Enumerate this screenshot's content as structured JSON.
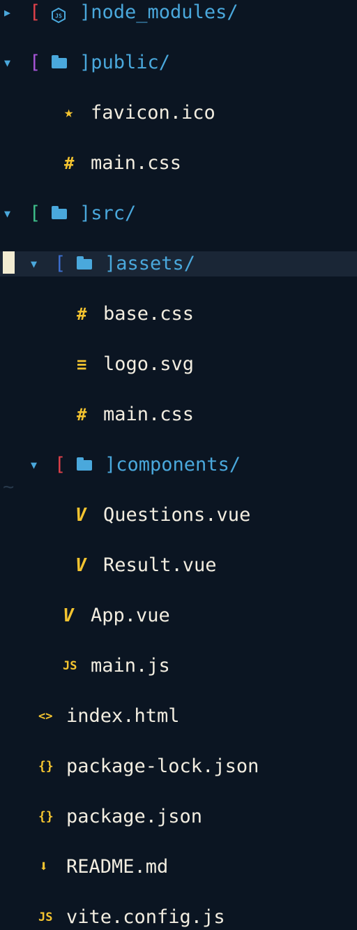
{
  "tree": {
    "node_modules": {
      "open_bracket": "[",
      "close_bracket": "]",
      "label": "node_modules/",
      "arrow": "▶",
      "icon": "nodejs-icon"
    },
    "public": {
      "open_bracket": "[",
      "close_bracket": "]",
      "label": "public/",
      "arrow": "▼"
    },
    "public_children": [
      {
        "label": "favicon.ico",
        "icon_glyph": "★",
        "icon": "star-icon"
      },
      {
        "label": "main.css",
        "icon_glyph": "#",
        "icon": "hash-icon"
      }
    ],
    "src": {
      "open_bracket": "[",
      "close_bracket": "]",
      "label": "src/",
      "arrow": "▼"
    },
    "assets": {
      "open_bracket": "[",
      "close_bracket": "]",
      "label": "assets/",
      "arrow": "▼"
    },
    "assets_children": [
      {
        "label": "base.css",
        "icon_glyph": "#",
        "icon": "hash-icon"
      },
      {
        "label": "logo.svg",
        "icon_glyph": "≡",
        "icon": "lines-icon"
      },
      {
        "label": "main.css",
        "icon_glyph": "#",
        "icon": "hash-icon"
      }
    ],
    "components": {
      "open_bracket": "[",
      "close_bracket": "]",
      "label": "components/",
      "arrow": "▼"
    },
    "components_children": [
      {
        "label": "Questions.vue",
        "icon_glyph": "V",
        "icon": "vue-icon"
      },
      {
        "label": "Result.vue",
        "icon_glyph": "V",
        "icon": "vue-icon"
      }
    ],
    "src_children": [
      {
        "label": "App.vue",
        "icon_glyph": "V",
        "icon": "vue-icon"
      },
      {
        "label": "main.js",
        "icon_glyph": "JS",
        "icon": "js-icon"
      }
    ],
    "root_children": [
      {
        "label": "index.html",
        "icon_glyph": "<>",
        "icon": "html-icon"
      },
      {
        "label": "package-lock.json",
        "icon_glyph": "{}",
        "icon": "json-icon"
      },
      {
        "label": "package.json",
        "icon_glyph": "{}",
        "icon": "json-icon"
      },
      {
        "label": "README.md",
        "icon_glyph": "⬇",
        "icon": "markdown-icon"
      },
      {
        "label": "vite.config.js",
        "icon_glyph": "JS",
        "icon": "js-icon"
      }
    ],
    "end_marker": "~"
  },
  "colors": {
    "background": "#0b1522",
    "folder": "#4aa8dc",
    "file_text": "#f2ede0",
    "icon_yellow": "#f4c430",
    "bracket_red": "#e0414a",
    "bracket_purple": "#a855d8",
    "bracket_green": "#3fbf8a",
    "bracket_blue": "#3d6fd0",
    "arrow": "#4aa8dc",
    "cursor_row": "#1a2636"
  }
}
